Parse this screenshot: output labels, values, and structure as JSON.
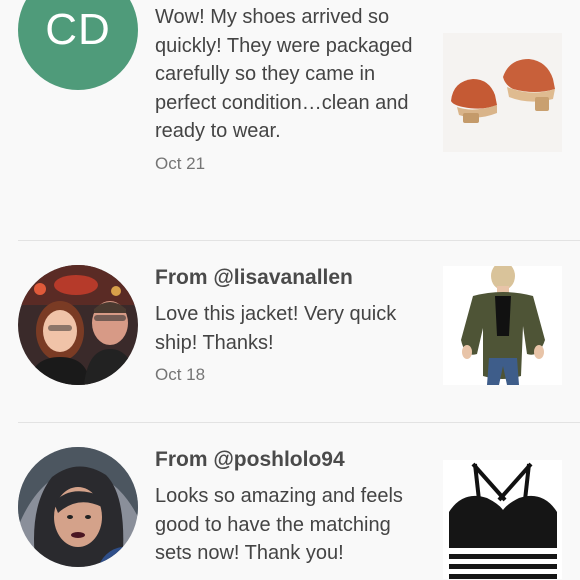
{
  "items": [
    {
      "avatar_initials": "CD",
      "from": "",
      "message": "Wow! My shoes arrived so quickly! They were packaged carefully so they came in perfect condition…clean and ready to wear.",
      "date": "Oct 21",
      "thumb_icon": "shoes-icon",
      "avatar_color": "#4f9b7a"
    },
    {
      "from": "From @lisavanallen",
      "message": "Love this jacket! Very quick ship! Thanks!",
      "date": "Oct 18",
      "thumb_icon": "jacket-icon"
    },
    {
      "from": "From @poshlolo94",
      "message": "Looks so amazing and feels good to have the matching sets now! Thank you!",
      "date": "",
      "thumb_icon": "sports-bra-icon"
    }
  ],
  "colors": {
    "background": "#f9f9f9",
    "divider": "#e3e3e3",
    "avatar_green": "#4f9b7a"
  }
}
